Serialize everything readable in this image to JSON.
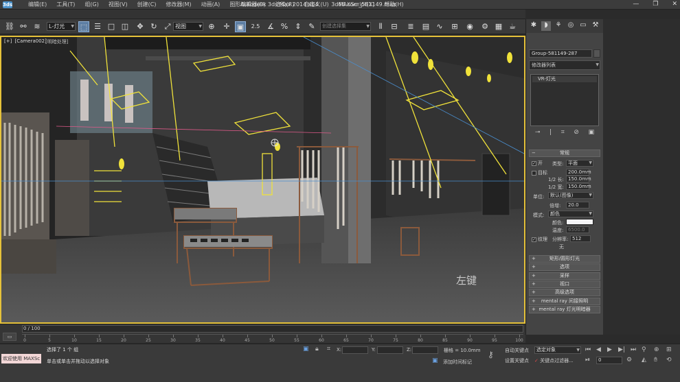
{
  "window": {
    "app_icon": "3ds",
    "title_app": "Autodesk 3ds Max  2014 x64",
    "title_file": "3d66.com_581149.max",
    "controls": [
      "—",
      "❐",
      "✕"
    ]
  },
  "menu": [
    "编辑(E)",
    "工具(T)",
    "组(G)",
    "视图(V)",
    "创建(C)",
    "修改器(M)",
    "动画(A)",
    "图形编辑器(D)",
    "渲染(R)",
    "自定义(U)",
    "MAXScript(X)",
    "帮助(H)"
  ],
  "toolbar": {
    "selection_filter": "L-灯光",
    "reference_coord": "视图",
    "named_selection": "创建选择集",
    "snap_label": "2.5"
  },
  "viewport": {
    "label_plus": "[+]",
    "label_camera": "[Camera002]",
    "label_mode": "[明暗处理]",
    "overlay_text": "左键",
    "border_color": "#e6c23a"
  },
  "command_panel": {
    "object_name": "Group-581149-287",
    "modifier_list": "修改器列表",
    "stack_item": "VR-灯光",
    "stack_tools": [
      "⊸",
      "|",
      "⌗",
      "⊘",
      "▣"
    ],
    "general_rollout": "常规",
    "on_label": "开",
    "type_label": "类型:",
    "type_value": "平面",
    "target_label": "目标",
    "target_value": "200.0mm",
    "half_length_label": "1/2 长:",
    "half_length_value": "150.0mm",
    "half_width_label": "1/2 宽:",
    "half_width_value": "150.0mm",
    "units_label": "单位:",
    "units_value": "默认(图像)",
    "multiplier_label": "倍增:",
    "multiplier_value": "20.0",
    "mode_label": "模式:",
    "mode_value": "颜色",
    "color_label": "颜色:",
    "temperature_label": "温度:",
    "temperature_value": "6500.0",
    "texture_label": "纹理",
    "resolution_label": "分辨率:",
    "resolution_value": "512",
    "none_label": "无",
    "collapsed_rollouts": [
      "矩形/圆形灯光",
      "选项",
      "采样",
      "视口",
      "高级选项",
      "mental ray 间接照明",
      "mental ray 灯光明暗器"
    ]
  },
  "timeline": {
    "slider_text": "0 / 100",
    "ticks": [
      "0",
      "5",
      "10",
      "15",
      "20",
      "25",
      "30",
      "35",
      "40",
      "45",
      "50",
      "55",
      "60",
      "65",
      "70",
      "75",
      "80",
      "85",
      "90",
      "95",
      "100"
    ]
  },
  "status": {
    "maxscript_label": "欢迎使用 MAXSc",
    "selection_info": "选择了 1 个 组",
    "prompt": "单击或单击并拖动以选择对象",
    "x_label": "X:",
    "y_label": "Y:",
    "z_label": "Z:",
    "grid": "栅格 = 10.0mm",
    "add_time_tag": "添加时间标记",
    "auto_key": "自动关键点",
    "set_key": "设置关键点",
    "selected_object": "选定对象",
    "key_filters": "关键点过滤器...",
    "frame_value": "0"
  }
}
